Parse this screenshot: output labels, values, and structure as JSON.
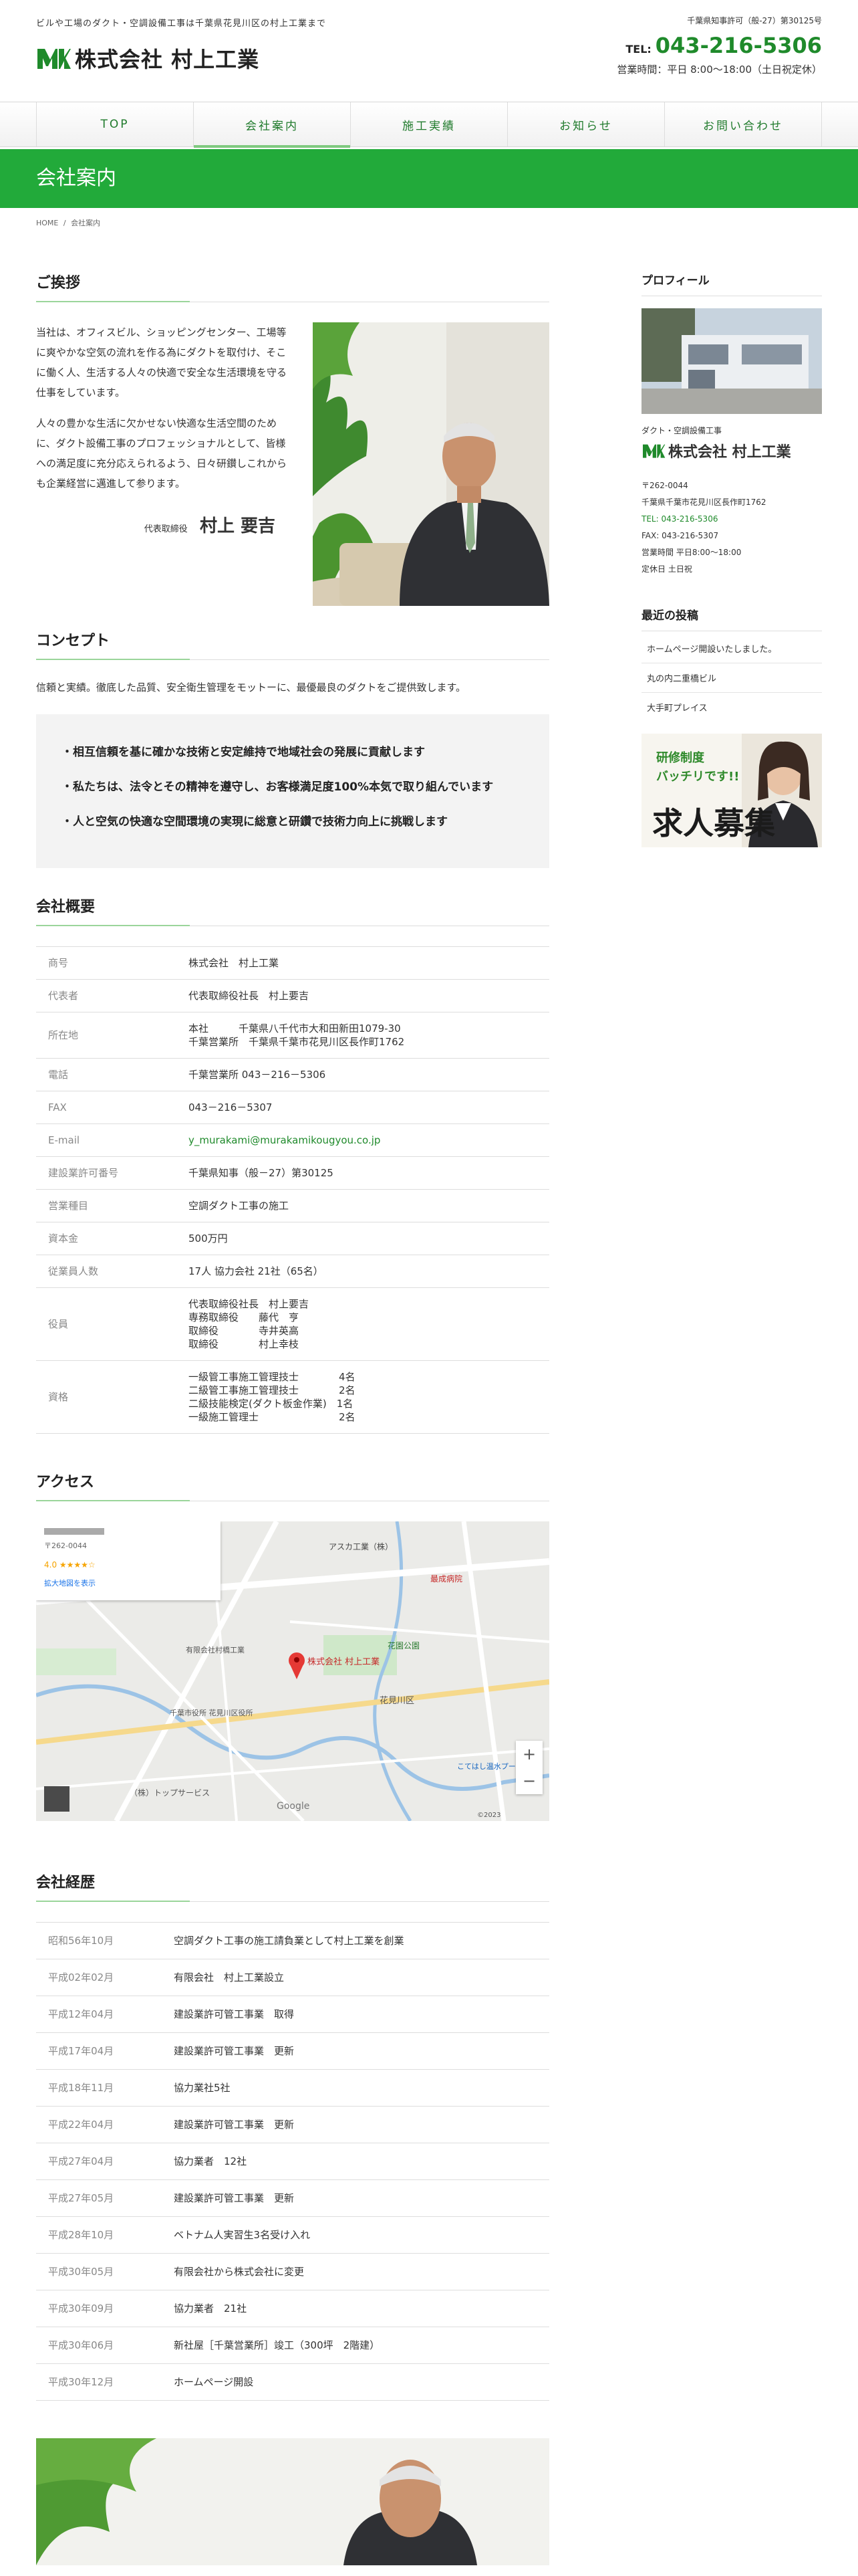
{
  "header": {
    "tagline": "ビルや工場のダクト・空調設備工事は千葉県花見川区の村上工業まで",
    "logo_text": "株式会社 村上工業",
    "license": "千葉県知事許可（般-27）第30125号",
    "tel_label": "TEL:",
    "tel": "043-216-5306",
    "hours": "営業時間：平日 8:00～18:00（土日祝定休）"
  },
  "nav": [
    "TOP",
    "会社案内",
    "施工実績",
    "お知らせ",
    "お問い合わせ"
  ],
  "page_title": "会社案内",
  "breadcrumb": {
    "home": "HOME",
    "sep": "/",
    "current": "会社案内"
  },
  "greeting": {
    "heading": "ご挨拶",
    "p1": "当社は、オフィスビル、ショッピングセンター、工場等に爽やかな空気の流れを作る為にダクトを取付け、そこに働く人、生活する人々の快適で安全な生活環境を守る仕事をしています。",
    "p2": "人々の豊かな生活に欠かせない快適な生活空間のために、ダクト設備工事のプロフェッショナルとして、皆様への満足度に充分応えられるよう、日々研鑚しこれからも企業経営に邁進して参ります。",
    "sign_title": "代表取締役",
    "sign_name": "村上 要吉"
  },
  "concept": {
    "heading": "コンセプト",
    "lead": "信頼と実績。徹底した品質、安全衛生管理をモットーに、最優最良のダクトをご提供致します。",
    "items": [
      "・相互信頼を基に確かな技術と安定維持で地域社会の発展に貢献します",
      "・私たちは、法令とその精神を遵守し、お客様満足度100%本気で取り組んでいます",
      "・人と空気の快適な空間環境の実現に総意と研鑽で技術力向上に挑戦します"
    ]
  },
  "overview": {
    "heading": "会社概要",
    "rows": [
      {
        "label": "商号",
        "lines": [
          "株式会社　村上工業"
        ]
      },
      {
        "label": "代表者",
        "lines": [
          "代表取締役社長　村上要吉"
        ]
      },
      {
        "label": "所在地",
        "lines": [
          "本社　　　千葉県八千代市大和田新田1079-30",
          "千葉営業所　千葉県千葉市花見川区長作町1762"
        ]
      },
      {
        "label": "電話",
        "lines": [
          "千葉営業所 043－216－5306"
        ]
      },
      {
        "label": "FAX",
        "lines": [
          "043－216－5307"
        ]
      },
      {
        "label": "E-mail",
        "lines": [
          "y_murakami@murakamikougyou.co.jp"
        ]
      },
      {
        "label": "建設業許可番号",
        "lines": [
          "千葉県知事（般－27）第30125"
        ]
      },
      {
        "label": "営業種目",
        "lines": [
          "空調ダクト工事の施工"
        ]
      },
      {
        "label": "資本金",
        "lines": [
          "500万円"
        ]
      },
      {
        "label": "従業員人数",
        "lines": [
          "17人 協力会社 21社（65名）"
        ]
      },
      {
        "label": "役員",
        "lines": [
          "代表取締役社長　村上要吉",
          "専務取締役　　藤代　亨",
          "取締役　　　　寺井英高",
          "取締役　　　　村上幸枝"
        ]
      },
      {
        "label": "資格",
        "lines": [
          "一級管工事施工管理技士　　　　4名",
          "二級管工事施工管理技士　　　　2名",
          "二級技能検定(ダクト板金作業)　1名",
          "一級施工管理士　　　　　　　　2名"
        ]
      }
    ]
  },
  "access": {
    "heading": "アクセス",
    "map_marker": "株式会社 村上工業",
    "card_zip": "〒262-0044",
    "card_rating": "4.0 ★★★★☆",
    "card_link": "拡大地図を表示",
    "labels": [
      "アスカ工業（株）",
      "花見川区",
      "花園公園",
      "千葉市役所 花見川区役所",
      "有限会社村橋工業",
      "（株）トップサービス",
      "最成病院",
      "こてはし温水プール",
      "Google",
      "©2023"
    ],
    "zoom_in": "+",
    "zoom_out": "−"
  },
  "history": {
    "heading": "会社経歴",
    "rows": [
      {
        "date": "昭和56年10月",
        "text": "空調ダクト工事の施工請負業として村上工業を創業"
      },
      {
        "date": "平成02年02月",
        "text": "有限会社　村上工業設立"
      },
      {
        "date": "平成12年04月",
        "text": "建設業許可管工事業　取得"
      },
      {
        "date": "平成17年04月",
        "text": "建設業許可管工事業　更新"
      },
      {
        "date": "平成18年11月",
        "text": "協力業社5社"
      },
      {
        "date": "平成22年04月",
        "text": "建設業許可管工事業　更新"
      },
      {
        "date": "平成27年04月",
        "text": "協力業者　12社"
      },
      {
        "date": "平成27年05月",
        "text": "建設業許可管工事業　更新"
      },
      {
        "date": "平成28年10月",
        "text": "ベトナム人実習生3名受け入れ"
      },
      {
        "date": "平成30年05月",
        "text": "有限会社から株式会社に変更"
      },
      {
        "date": "平成30年09月",
        "text": "協力業者　21社"
      },
      {
        "date": "平成30年06月",
        "text": "新社屋［千葉営業所］竣工（300坪　2階建）"
      },
      {
        "date": "平成30年12月",
        "text": "ホームページ開設"
      }
    ]
  },
  "sidebar": {
    "profile_heading": "プロフィール",
    "category": "ダクト・空調設備工事",
    "logo_text": "株式会社 村上工業",
    "address": [
      "〒262-0044",
      "千葉県千葉市花見川区長作町1762"
    ],
    "tel": "TEL: 043-216-5306",
    "fax": "FAX: 043-216-5307",
    "hours": "営業時間 平日8:00～18:00",
    "holiday": "定休日 土日祝",
    "posts_heading": "最近の投稿",
    "posts": [
      "ホームページ開設いたしました。",
      "丸の内二重橋ビル",
      "大手町プレイス"
    ],
    "recruit_sub1": "研修制度",
    "recruit_sub2": "バッチリです!!",
    "recruit_main": "求人募集"
  }
}
